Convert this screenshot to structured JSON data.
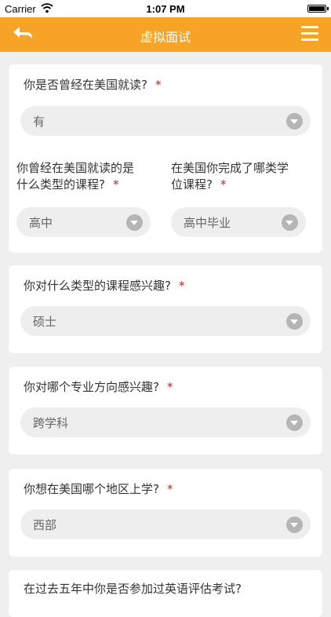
{
  "status_bar": {
    "carrier": "Carrier",
    "time": "1:07 PM"
  },
  "nav": {
    "title": "虚拟面试"
  },
  "questions": {
    "q1": {
      "label": "你是否曾经在美国就读?",
      "required": "*",
      "value": "有"
    },
    "q2a": {
      "label_line1": "你曾经在美国就读的是",
      "label_line2": "什么类型的课程?",
      "required": "*",
      "value": "高中"
    },
    "q2b": {
      "label_line1": "在美国你完成了哪类学",
      "label_line2": "位课程?",
      "required": "*",
      "value": "高中毕业"
    },
    "q3": {
      "label": "你对什么类型的课程感兴趣?",
      "required": "*",
      "value": "硕士"
    },
    "q4": {
      "label": "你对哪个专业方向感兴趣?",
      "required": "*",
      "value": "跨学科"
    },
    "q5": {
      "label": "你想在美国哪个地区上学?",
      "required": "*",
      "value": "西部"
    },
    "q6": {
      "label": "在过去五年中你是否参加过英语评估考试?"
    }
  },
  "colors": {
    "accent": "#f7a326",
    "required": "#cc1f1f",
    "background": "#efefef"
  },
  "icons": {
    "back": "back-arrow-icon",
    "menu": "hamburger-menu-icon",
    "dropdown": "chevron-down-icon"
  }
}
